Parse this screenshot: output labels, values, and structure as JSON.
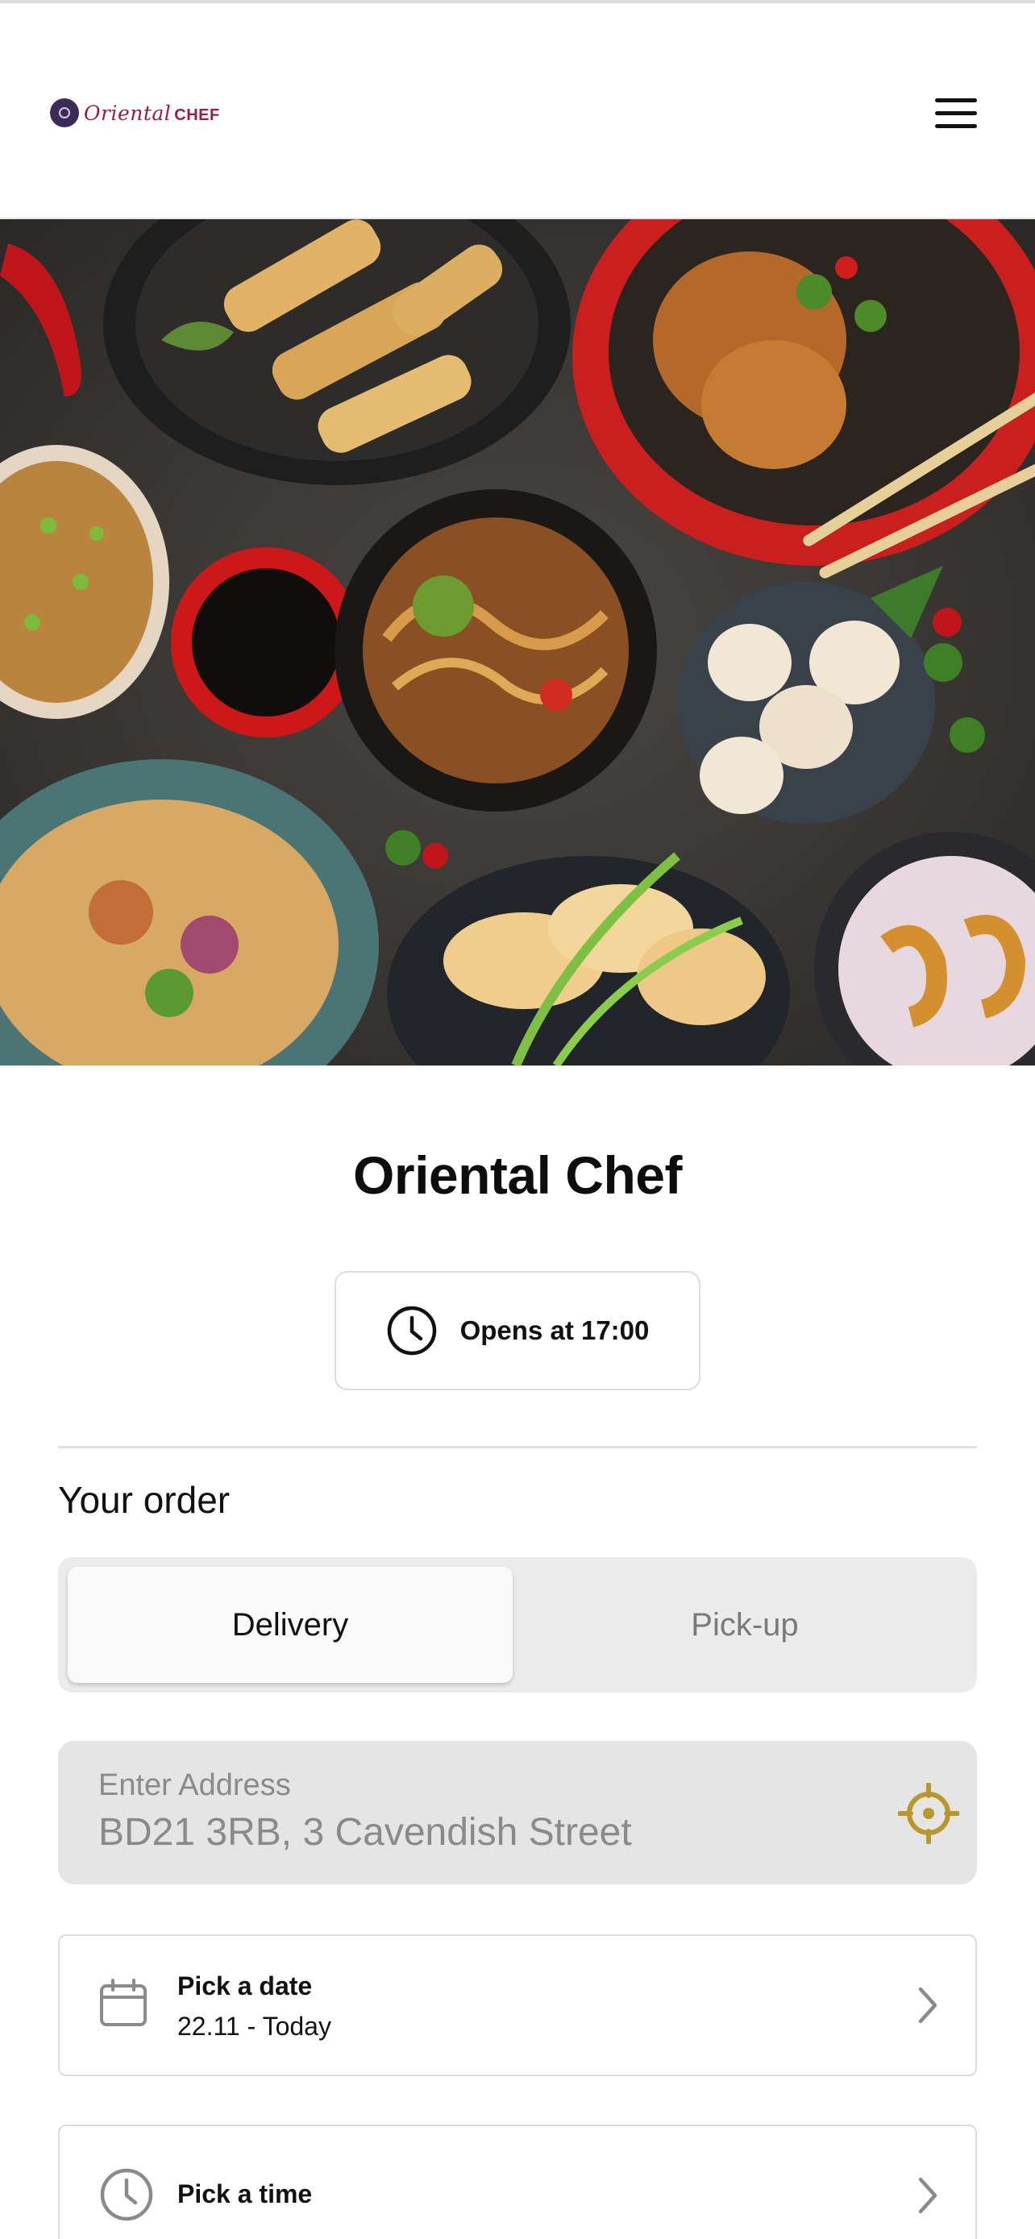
{
  "header": {
    "logo_text": "Oriental",
    "logo_text_bold": "CHEF",
    "menu_icon": "hamburger-menu-icon"
  },
  "hero": {
    "image_description_icon": "food-photo"
  },
  "restaurant": {
    "name": "Oriental Chef",
    "hours_text": "Opens at 17:00",
    "hours_icon": "clock-icon"
  },
  "order": {
    "section_title": "Your order",
    "modes": [
      {
        "label": "Delivery",
        "selected": true
      },
      {
        "label": "Pick-up",
        "selected": false
      }
    ],
    "address": {
      "label": "Enter Address",
      "value": "BD21 3RB, 3 Cavendish Street",
      "locate_icon": "crosshair-icon"
    },
    "date": {
      "title": "Pick a date",
      "value": "22.11 - Today",
      "icon": "calendar-icon"
    },
    "time": {
      "title": "Pick a time",
      "icon": "clock-icon"
    }
  },
  "colors": {
    "brand": "#9c1c4a",
    "locate_accent": "#b8972e",
    "segment_bg": "#ececec",
    "input_bg": "#e5e5e5"
  }
}
